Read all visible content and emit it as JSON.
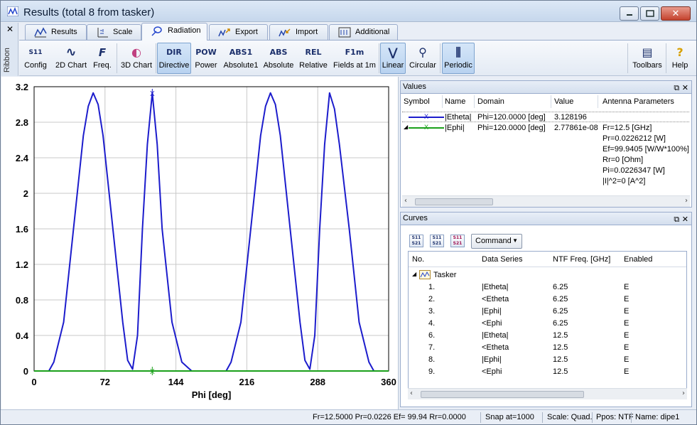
{
  "window": {
    "title": "Results (total 8 from tasker)",
    "ribbon_label": "Ribbon"
  },
  "tabs": [
    {
      "label": "Results",
      "icon": "results-chart-icon"
    },
    {
      "label": "Scale",
      "icon": "scale-icon"
    },
    {
      "label": "Radiation",
      "icon": "radiation-icon",
      "active": true
    },
    {
      "label": "Export",
      "icon": "export-icon"
    },
    {
      "label": "Import",
      "icon": "import-icon"
    },
    {
      "label": "Additional",
      "icon": "additional-icon"
    }
  ],
  "toolbar": {
    "buttons": [
      {
        "label": "Config",
        "icon_text": "S11",
        "icon": "config-icon"
      },
      {
        "label": "2D Chart",
        "icon_text": "∿",
        "icon": "2d-chart-icon"
      },
      {
        "label": "Freq.",
        "icon_text": "F",
        "icon": "frequency-icon"
      },
      {
        "label": "3D Chart",
        "icon_text": "◐",
        "icon": "3d-chart-icon"
      },
      {
        "label": "Directive",
        "icon_text": "DIR",
        "icon": "directive-icon",
        "active": true
      },
      {
        "label": "Power",
        "icon_text": "POW",
        "icon": "power-icon"
      },
      {
        "label": "Absolute1",
        "icon_text": "ABS1",
        "icon": "absolute1-icon"
      },
      {
        "label": "Absolute",
        "icon_text": "ABS",
        "icon": "absolute-icon"
      },
      {
        "label": "Relative",
        "icon_text": "REL",
        "icon": "relative-icon"
      },
      {
        "label": "Fields at 1m",
        "icon_text": "F1m",
        "icon": "fields-1m-icon"
      },
      {
        "label": "Linear",
        "icon_text": "⋁",
        "icon": "linear-icon",
        "active": true
      },
      {
        "label": "Circular",
        "icon_text": "⚲",
        "icon": "circular-icon"
      },
      {
        "label": "Periodic",
        "icon_text": "⫼",
        "icon": "periodic-icon",
        "active": true
      },
      {
        "label": "Toolbars",
        "icon_text": "▤",
        "icon": "toolbars-icon"
      },
      {
        "label": "Help",
        "icon_text": "?",
        "icon": "help-icon"
      }
    ]
  },
  "chart": {
    "xlabel": "Phi [deg]",
    "x_ticks": [
      "0",
      "72",
      "144",
      "216",
      "288",
      "360"
    ],
    "y_ticks": [
      "0",
      "0.4",
      "0.8",
      "1.2",
      "1.6",
      "2",
      "2.4",
      "2.8",
      "3.2"
    ]
  },
  "chart_data": {
    "type": "line",
    "xlabel": "Phi [deg]",
    "ylabel": "",
    "xlim": [
      0,
      360
    ],
    "ylim": [
      0,
      3.2
    ],
    "grid": true,
    "series": [
      {
        "name": "|Etheta|",
        "color": "#1c1ccc",
        "x": [
          0,
          15,
          20,
          30,
          40,
          50,
          55,
          60,
          65,
          70,
          80,
          90,
          95,
          100,
          105,
          110,
          115,
          120,
          125,
          130,
          140,
          150,
          160,
          165,
          175,
          180,
          195,
          200,
          210,
          220,
          230,
          235,
          240,
          245,
          250,
          260,
          270,
          275,
          280,
          285,
          290,
          295,
          300,
          305,
          310,
          320,
          330,
          340,
          345,
          360
        ],
        "y": [
          0,
          0,
          0.1,
          0.55,
          1.6,
          2.65,
          2.98,
          3.13,
          3.0,
          2.65,
          1.6,
          0.55,
          0.12,
          0.02,
          0.4,
          1.6,
          2.55,
          3.13,
          2.55,
          1.6,
          0.55,
          0.1,
          0,
          0,
          0,
          0,
          0,
          0.1,
          0.55,
          1.6,
          2.65,
          2.98,
          3.13,
          3.0,
          2.65,
          1.6,
          0.55,
          0.12,
          0.02,
          0.4,
          1.6,
          2.55,
          3.13,
          2.95,
          2.55,
          1.6,
          0.55,
          0.1,
          0,
          0
        ]
      },
      {
        "name": "|Ephi|",
        "color": "#1aa01a",
        "x": [
          0,
          360
        ],
        "y": [
          0,
          0
        ]
      }
    ],
    "markers": [
      {
        "series": "|Etheta|",
        "x": 120,
        "y": 3.128196
      },
      {
        "series": "|Ephi|",
        "x": 120,
        "y": 0
      }
    ]
  },
  "values_panel": {
    "title": "Values",
    "columns": [
      "Symbol",
      "Name",
      "Domain",
      "Value",
      "Antenna Parameters"
    ],
    "rows": [
      {
        "name": "|Etheta|",
        "domain": "Phi=120.0000 [deg]",
        "value": "3.128196",
        "params": [],
        "color": "#1c1ccc"
      },
      {
        "name": "|Ephi|",
        "domain": "Phi=120.0000 [deg]",
        "value": "2.77861e-08",
        "color": "#1aa01a",
        "params": [
          "Fr=12.5 [GHz]",
          "Pr=0.0226212 [W]",
          "Ef=99.9405 [W/W*100%]",
          "Rr=0 [Ohm]",
          "Pi=0.0226347 [W]",
          "|I|^2=0 [A^2]"
        ]
      }
    ]
  },
  "curves_panel": {
    "title": "Curves",
    "command_label": "Command",
    "columns": [
      "No.",
      "Data Series",
      "NTF Freq. [GHz]",
      "Enabled"
    ],
    "group_label": "Tasker",
    "rows": [
      {
        "no": "1.",
        "series": "|Etheta|",
        "freq": "6.25",
        "enabled": "E"
      },
      {
        "no": "2.",
        "series": "<Etheta",
        "freq": "6.25",
        "enabled": "E"
      },
      {
        "no": "3.",
        "series": "|Ephi|",
        "freq": "6.25",
        "enabled": "E"
      },
      {
        "no": "4.",
        "series": "<Ephi",
        "freq": "6.25",
        "enabled": "E"
      },
      {
        "no": "6.",
        "series": "|Etheta|",
        "freq": "12.5",
        "enabled": "E"
      },
      {
        "no": "7.",
        "series": "<Etheta",
        "freq": "12.5",
        "enabled": "E"
      },
      {
        "no": "8.",
        "series": "|Ephi|",
        "freq": "12.5",
        "enabled": "E"
      },
      {
        "no": "9.",
        "series": "<Ephi",
        "freq": "12.5",
        "enabled": "E"
      }
    ]
  },
  "status": {
    "params": "Fr=12.5000 Pr=0.0226 Ef= 99.94 Rr=0.0000",
    "snap": "Snap at=1000",
    "scale": "Scale: Quad.",
    "ppos": "Ppos: NTF",
    "name": "Name: dipe1"
  }
}
